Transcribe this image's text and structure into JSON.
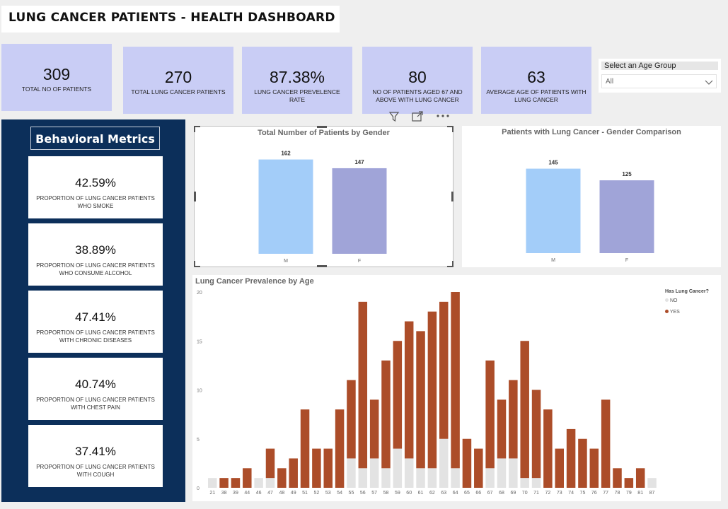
{
  "header": {
    "title": "LUNG CANCER PATIENTS - HEALTH DASHBOARD"
  },
  "kpis": [
    {
      "value": "309",
      "label": "TOTAL NO OF PATIENTS"
    },
    {
      "value": "270",
      "label": "TOTAL LUNG CANCER PATIENTS"
    },
    {
      "value": "87.38%",
      "label": "LUNG CANCER PREVELENCE RATE"
    },
    {
      "value": "80",
      "label": "NO OF PATIENTS AGED 67 AND ABOVE WITH LUNG CANCER"
    },
    {
      "value": "63",
      "label": "AVERAGE AGE OF PATIENTS WITH LUNG CANCER"
    }
  ],
  "slicer": {
    "title": "Select an Age Group",
    "selected": "All"
  },
  "behavioral": {
    "title": "Behavioral Metrics",
    "cards": [
      {
        "value": "42.59%",
        "label": "PROPORTION OF LUNG CANCER PATIENTS WHO SMOKE"
      },
      {
        "value": "38.89%",
        "label": "PROPORTION OF LUNG CANCER PATIENTS WHO CONSUME ALCOHOL"
      },
      {
        "value": "47.41%",
        "label": "PROPORTION OF LUNG CANCER PATIENTS WITH CHRONIC DISEASES"
      },
      {
        "value": "40.74%",
        "label": "PROPORTION OF LUNG CANCER PATIENTS WITH CHEST PAIN"
      },
      {
        "value": "37.41%",
        "label": "PROPORTION OF LUNG CANCER PATIENTS WITH COUGH"
      }
    ]
  },
  "icons": [
    "filter-icon",
    "expand-icon",
    "more-options-icon"
  ],
  "colors": {
    "male": "#a3cdf9",
    "female": "#a0a4d8",
    "yes": "#ac4d29",
    "no": "#e3e3e3",
    "kpi": "#c9cdf5",
    "sidebar": "#0c2f5a"
  },
  "chart_data": [
    {
      "type": "bar",
      "title": "Total Number of Patients by Gender",
      "categories": [
        "M",
        "F"
      ],
      "values": [
        162,
        147
      ],
      "ylim": [
        0,
        170
      ],
      "grid": false
    },
    {
      "type": "bar",
      "title": "Patients with Lung Cancer - Gender Comparison",
      "categories": [
        "M",
        "F"
      ],
      "values": [
        145,
        125
      ],
      "ylim": [
        0,
        170
      ],
      "grid": false
    },
    {
      "type": "bar",
      "stacked": true,
      "title": "Lung Cancer Prevalence by Age",
      "legend_title": "Has Lung Cancer?",
      "legend_position": "top-right",
      "categories": [
        "21",
        "38",
        "39",
        "44",
        "46",
        "47",
        "48",
        "49",
        "51",
        "52",
        "53",
        "54",
        "55",
        "56",
        "57",
        "58",
        "59",
        "60",
        "61",
        "62",
        "63",
        "64",
        "65",
        "66",
        "67",
        "68",
        "69",
        "70",
        "71",
        "72",
        "73",
        "74",
        "75",
        "76",
        "77",
        "78",
        "79",
        "81",
        "87"
      ],
      "series": [
        {
          "name": "NO",
          "values": [
            1,
            0,
            0,
            0,
            1,
            1,
            0,
            0,
            0,
            0,
            0,
            0,
            3,
            2,
            3,
            2,
            4,
            3,
            2,
            2,
            5,
            2,
            0,
            0,
            2,
            3,
            3,
            1,
            1,
            0,
            0,
            0,
            0,
            0,
            0,
            0,
            0,
            0,
            1
          ]
        },
        {
          "name": "YES",
          "values": [
            0,
            1,
            1,
            2,
            0,
            3,
            2,
            3,
            8,
            4,
            4,
            8,
            8,
            17,
            6,
            11,
            11,
            14,
            14,
            16,
            14,
            18,
            5,
            4,
            11,
            6,
            8,
            14,
            9,
            8,
            4,
            6,
            5,
            4,
            9,
            2,
            1,
            2,
            0
          ]
        }
      ],
      "yticks": [
        0,
        5,
        10,
        15,
        20
      ],
      "ylim": [
        0,
        20
      ],
      "grid": false
    }
  ]
}
